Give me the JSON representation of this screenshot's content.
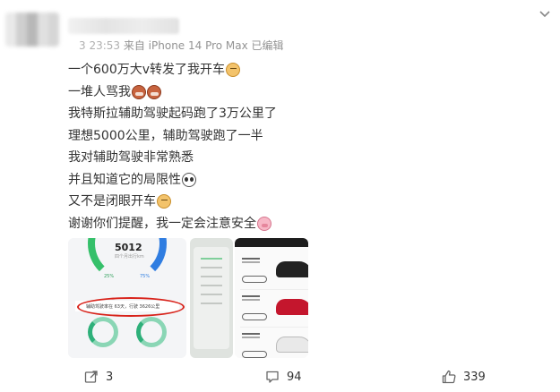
{
  "post": {
    "meta_time": "3 23:53",
    "meta_source": "来自 iPhone 14 Pro Max 已编辑",
    "lines": [
      "一个600万大v转发了我开车",
      "一堆人骂我",
      "我特斯拉辅助驾驶起码跑了3万公里了",
      "理想5000公里，辅助驾驶跑了一半",
      "我对辅助驾驶非常熟悉",
      "并且知道它的局限性",
      "又不是闭眼开车",
      "谢谢你们提醒，我一定会注意安全"
    ]
  },
  "images": {
    "image1": {
      "number": "5012",
      "small_caption": "四个月出行km",
      "pct_left": "25%",
      "pct_right": "75%",
      "circled_text": "辅助驾驶率在 63天，行驶 3626公里"
    }
  },
  "actions": {
    "share_count": "3",
    "comment_count": "94",
    "like_count": "339"
  }
}
